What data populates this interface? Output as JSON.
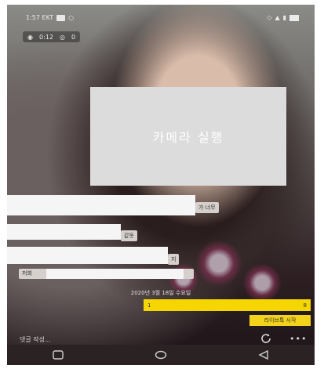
{
  "status_bar": {
    "time": "1:57 EKT"
  },
  "stats": {
    "duration": "0:12",
    "viewers": "0"
  },
  "camera_overlay": {
    "text": "카메라 실행"
  },
  "chat": {
    "messages": [
      {
        "text": "가 너무"
      },
      {
        "text": "같듯"
      },
      {
        "text": "지"
      },
      {
        "text": "저희"
      }
    ]
  },
  "date_text": "2020년 3월 18일 수요일",
  "yellow_bar": {
    "left": "1",
    "right": "8"
  },
  "start_button": {
    "label": "라이브톡 시작"
  },
  "comment": {
    "placeholder": "댓글 작성..."
  },
  "icons": {
    "status_left": [
      "box-icon",
      "circle-icon"
    ],
    "stats": [
      "headset-icon",
      "eye-icon"
    ],
    "bottom": [
      "refresh-icon",
      "more-icon"
    ],
    "nav": [
      "recent-apps-icon",
      "home-icon",
      "back-icon"
    ]
  },
  "colors": {
    "accent_yellow": "#f5d600",
    "start_button": "#f2d21a",
    "overlay": "#dcdcdc",
    "navbar": "#2b2224"
  }
}
